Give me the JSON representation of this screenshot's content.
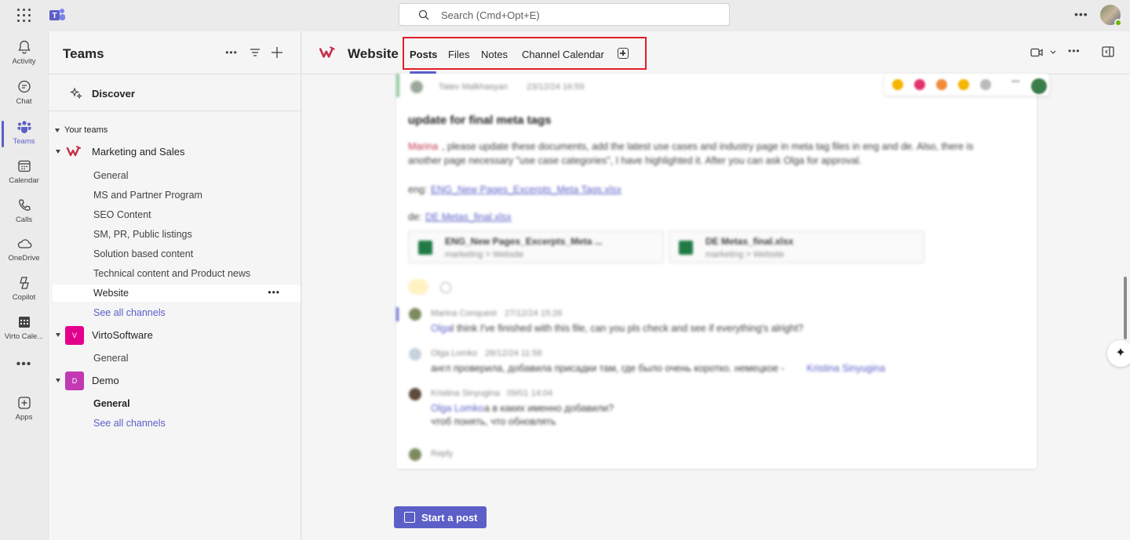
{
  "topbar": {
    "search_placeholder": "Search (Cmd+Opt+E)",
    "more_label": "•••"
  },
  "rail": {
    "items": [
      {
        "label": "Activity",
        "icon": "bell-icon"
      },
      {
        "label": "Chat",
        "icon": "chat-icon"
      },
      {
        "label": "Teams",
        "icon": "teams-icon",
        "active": true
      },
      {
        "label": "Calendar",
        "icon": "calendar-icon"
      },
      {
        "label": "Calls",
        "icon": "phone-icon"
      },
      {
        "label": "OneDrive",
        "icon": "cloud-icon"
      },
      {
        "label": "Copilot",
        "icon": "copilot-icon"
      },
      {
        "label": "Virto Cale...",
        "icon": "virto-calendar-icon"
      },
      {
        "label": "Apps",
        "icon": "apps-add-icon"
      }
    ],
    "more": "•••"
  },
  "panel": {
    "title": "Teams",
    "discover": "Discover",
    "your_teams": "Your teams",
    "teams": [
      {
        "name": "Marketing and Sales",
        "channels": [
          "General",
          "MS and Partner Program",
          "SEO Content",
          "SM, PR, Public listings",
          "Solution based content",
          "Technical content and Product news",
          "Website"
        ],
        "see_all": "See all channels"
      },
      {
        "name": "VirtoSoftware",
        "badge": "V",
        "badge_color": "#e3008c",
        "channels": [
          "General"
        ]
      },
      {
        "name": "Demo",
        "badge": "D",
        "badge_color": "#c239b3",
        "channels": [
          "General"
        ],
        "see_all": "See all channels"
      }
    ],
    "selected_more": "•••"
  },
  "main": {
    "channel_title": "Website",
    "tabs": [
      "Posts",
      "Files",
      "Notes",
      "Channel Calendar"
    ],
    "start_post": "Start a post"
  },
  "post": {
    "author": "Tatev Malkhasyan",
    "time": "23/12/24 16:59",
    "subject": "update for final meta tags",
    "mention": "Marina",
    "body1": ", please update these documents, add the latest use cases and industry page in meta tag files in eng and de. Also, there is",
    "body2": "another page necessary \"use case categories\", I have highlighted it. After you can ask Olga for approval.",
    "eng_label": "eng:",
    "eng_link": "ENG_New Pages_Excerpts_Meta Tags.xlsx",
    "de_label": "de:",
    "de_link": "DE Metas_final.xlsx",
    "file1_name": "ENG_New Pages_Excerpts_Meta ...",
    "file1_path": "marketing > Website",
    "file2_name": "DE Metas_final.xlsx",
    "file2_path": "marketing > Website",
    "replies": [
      {
        "author": "Marina Conquest",
        "time": "27/12/24 15:26",
        "mention": "Olga",
        "text": " I think I've finished with this file, can you pls check and see if everything's alright?"
      },
      {
        "author": "Olga Lomko",
        "time": "28/12/24 11:58",
        "text": "англ проверила, добавила присадки там, где было очень коротко. немецкое - ",
        "mention_after": "Kristina Sinyugina"
      },
      {
        "author": "Kristina Sinyugina",
        "time": "09/01 14:04",
        "mention": "Olga Lomko",
        "text": " а в каких именно добавили?",
        "text2": "чтоб понять, что обновлять"
      }
    ],
    "reply": "Reply"
  }
}
